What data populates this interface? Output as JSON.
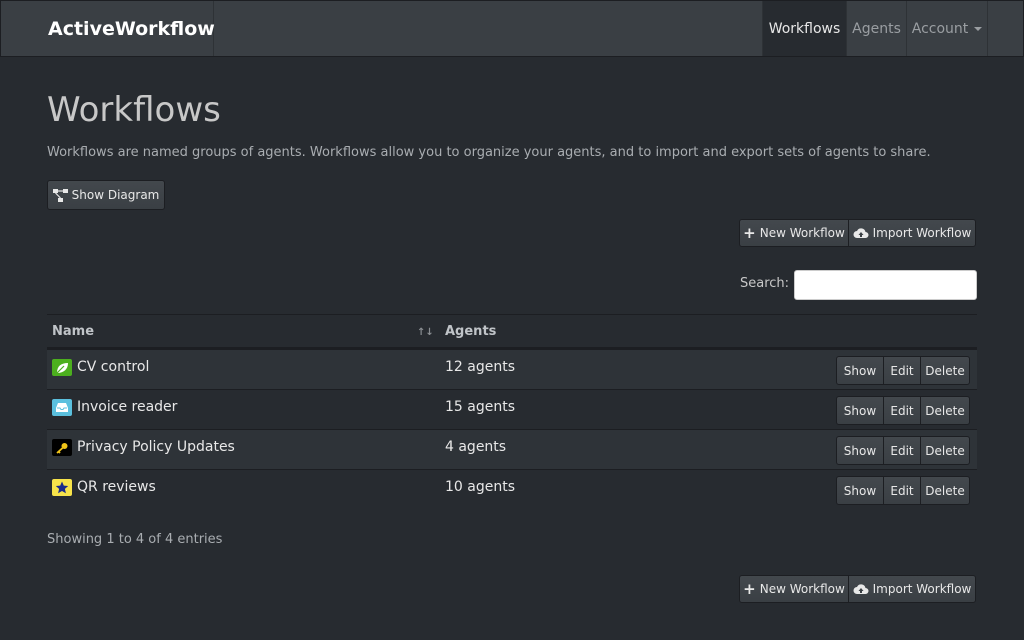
{
  "navbar": {
    "brand": "ActiveWorkflow",
    "items": [
      {
        "label": "Workflows",
        "active": true
      },
      {
        "label": "Agents",
        "active": false
      },
      {
        "label": "Account",
        "active": false
      }
    ]
  },
  "page": {
    "title": "Workflows",
    "intro": "Workflows are named groups of agents. Workflows allow you to organize your agents, and to import and export sets of agents to share.",
    "show_diagram_label": "Show Diagram",
    "new_workflow_label": "New Workflow",
    "import_workflow_label": "Import Workflow",
    "search_label": "Search:"
  },
  "table": {
    "columns": [
      "Name",
      "Agents"
    ],
    "rows": [
      {
        "name": "CV control",
        "agents": "12 agents",
        "icon": "leaf-icon",
        "icon_bg": "#4caf1e",
        "icon_fg": "#ffffff"
      },
      {
        "name": "Invoice reader",
        "agents": "15 agents",
        "icon": "tray-icon",
        "icon_bg": "#5bc0de",
        "icon_fg": "#ffffff"
      },
      {
        "name": "Privacy Policy Updates",
        "agents": "4 agents",
        "icon": "key-icon",
        "icon_bg": "#000000",
        "icon_fg": "#f0c419"
      },
      {
        "name": "QR reviews",
        "agents": "10 agents",
        "icon": "star-icon",
        "icon_bg": "#f7e34a",
        "icon_fg": "#1a2a8a"
      }
    ],
    "actions": {
      "show": "Show",
      "edit": "Edit",
      "delete": "Delete"
    },
    "info": "Showing 1 to 4 of 4 entries"
  }
}
